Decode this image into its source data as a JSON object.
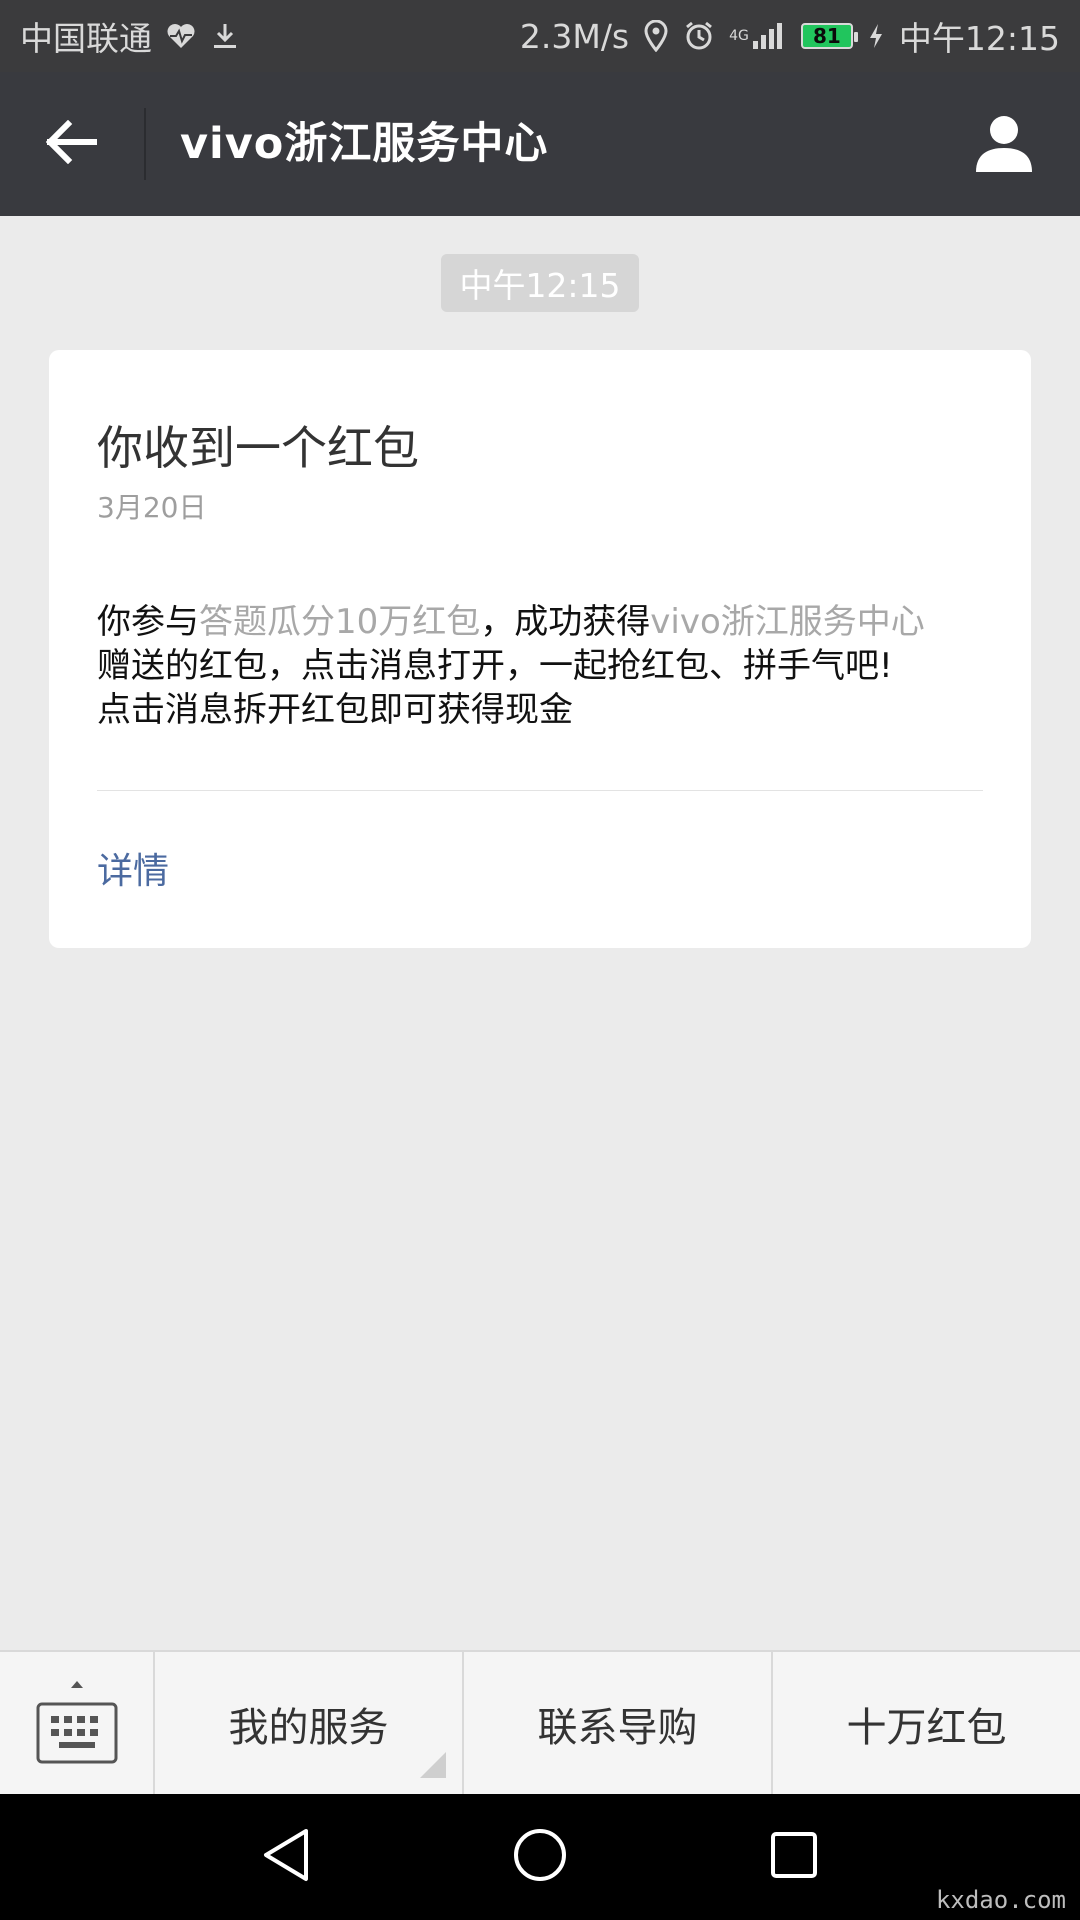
{
  "status_bar": {
    "carrier": "中国联通",
    "net_speed": "2.3M/s",
    "network_type": "4G",
    "battery_level": "81",
    "time": "中午12:15",
    "icons": [
      "heart-pulse-icon",
      "download-icon",
      "location-icon",
      "alarm-icon",
      "signal-icon",
      "charging-icon"
    ]
  },
  "nav": {
    "title": "vivo浙江服务中心",
    "icons": [
      "back-arrow-icon",
      "profile-icon"
    ]
  },
  "chat": {
    "time_badge": "中午12:15"
  },
  "card": {
    "title": "你收到一个红包",
    "date": "3月20日",
    "body": {
      "part1": "你参与",
      "part2_muted": "答题瓜分10万红包",
      "part3": "，成功获得",
      "part4_muted": "vivo浙江服务中心",
      "line2": "赠送的红包，点击消息打开，一起抢红包、拼手气吧!",
      "line3": "点击消息拆开红包即可获得现金"
    },
    "link": "详情"
  },
  "menu": {
    "items": [
      {
        "label": "我的服务"
      },
      {
        "label": "联系导购"
      },
      {
        "label": "十万红包"
      }
    ],
    "icons": [
      "keyboard-icon",
      "submenu-indicator-icon"
    ]
  },
  "system_nav": {
    "icons": [
      "back-triangle-icon",
      "home-circle-icon",
      "recent-square-icon"
    ]
  },
  "watermark": "kxdao.com",
  "colors": {
    "nav_bg": "#393a3f",
    "status_bg": "#3b3b3d",
    "page_bg": "#ebebeb",
    "link_blue": "#4b6aa0",
    "muted_text": "#a8a8a8",
    "battery_green": "#21c55d"
  }
}
